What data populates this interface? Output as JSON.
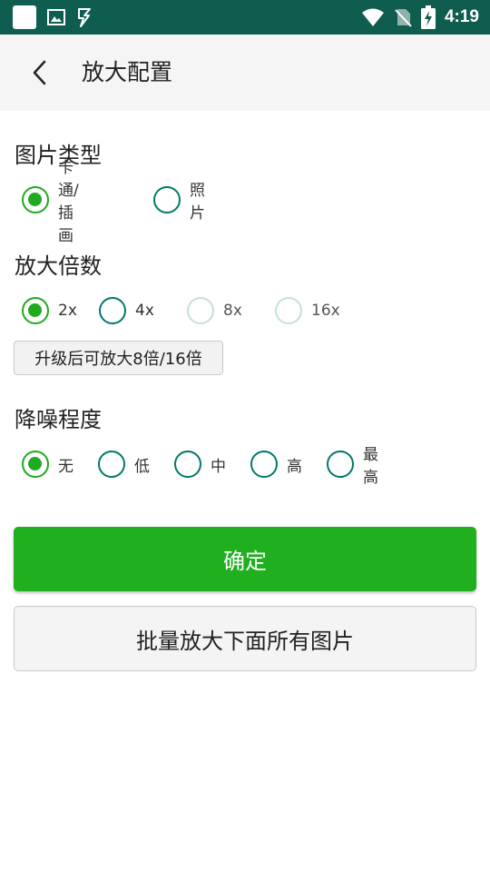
{
  "status_bar": {
    "time": "4:19",
    "icons": [
      "notification-square-icon",
      "image-icon",
      "bolt-icon",
      "wifi-icon",
      "no-sim-icon",
      "battery-charging-icon"
    ]
  },
  "app_bar": {
    "title": "放大配置",
    "back_icon": "chevron-left-icon"
  },
  "image_type": {
    "title": "图片类型",
    "options": [
      {
        "label": "卡通/插画",
        "checked": true
      },
      {
        "label": "照片",
        "checked": false
      }
    ]
  },
  "scale": {
    "title": "放大倍数",
    "options": [
      {
        "label": "2x",
        "checked": true,
        "enabled": true
      },
      {
        "label": "4x",
        "checked": false,
        "enabled": true
      },
      {
        "label": "8x",
        "checked": false,
        "enabled": false
      },
      {
        "label": "16x",
        "checked": false,
        "enabled": false
      }
    ],
    "upgrade_label": "升级后可放大8倍/16倍"
  },
  "denoise": {
    "title": "降噪程度",
    "options": [
      {
        "label": "无",
        "checked": true
      },
      {
        "label": "低",
        "checked": false
      },
      {
        "label": "中",
        "checked": false
      },
      {
        "label": "高",
        "checked": false
      },
      {
        "label": "最高",
        "checked": false
      }
    ]
  },
  "actions": {
    "confirm_label": "确定",
    "batch_label": "批量放大下面所有图片"
  },
  "colors": {
    "status_bar": "#0f5d4e",
    "accent_green": "#1faf1f",
    "radio_teal": "#00796b"
  }
}
